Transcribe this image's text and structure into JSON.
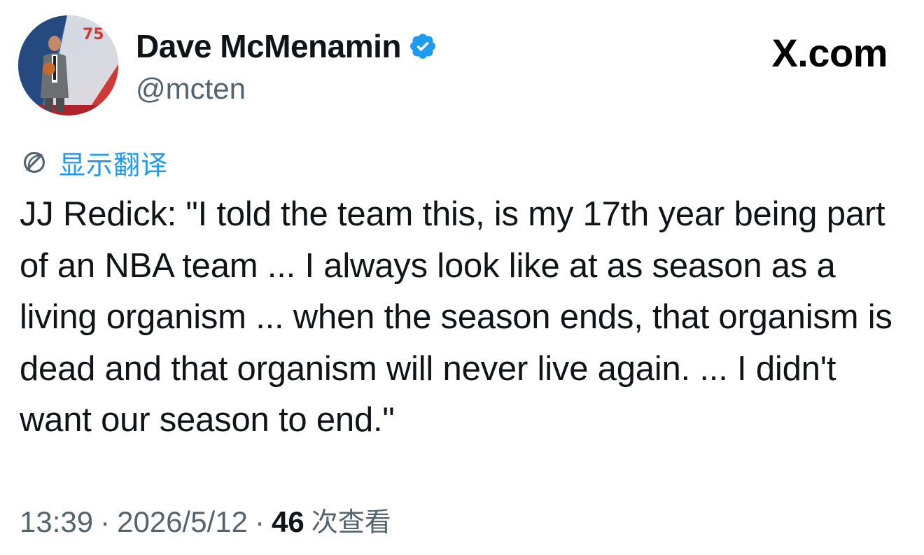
{
  "author": {
    "display_name": "Dave McMenamin",
    "handle": "@mcten",
    "verified_icon": "verified-badge-icon",
    "verified_color": "#1d9bf0"
  },
  "brand": {
    "logo_text": "X",
    "logo_suffix": ".com"
  },
  "translate": {
    "icon": "globe-icon",
    "label": "显示翻译",
    "color": "#1d9bf0"
  },
  "tweet": {
    "text": "JJ Redick: \"I told the team this, is my 17th year being part of an NBA team ... I always look like at as season as a living organism ... when the season ends, that organism is dead and that organism will never live again. ... I didn't want our season to end.\""
  },
  "meta": {
    "time": "13:39",
    "separator": "·",
    "date": "2026/5/12",
    "views_count": "46",
    "views_label": "次查看"
  }
}
